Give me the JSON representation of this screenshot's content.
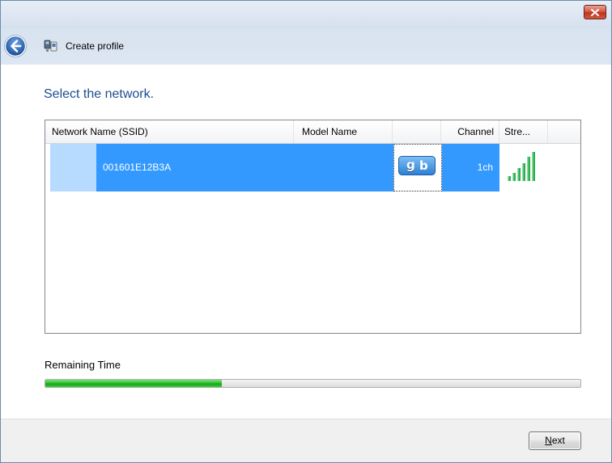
{
  "window": {
    "title": "Create profile"
  },
  "page": {
    "heading": "Select the network."
  },
  "list": {
    "columns": [
      "Network Name (SSID)",
      "Model Name",
      "",
      "Channel",
      "Stre..."
    ],
    "rows": [
      {
        "ssid": "001601E12B3A",
        "model_name": "",
        "type_icon": "gb-wireless-icon",
        "channel": "1ch",
        "strength_icon": "signal-strength-icon",
        "selected": true
      }
    ]
  },
  "progress": {
    "label": "Remaining Time",
    "value": 0.33
  },
  "footer": {
    "next_prefix": "N",
    "next_rest": "ext"
  },
  "colors": {
    "selection": "#3399ff",
    "heading": "#1e4d91",
    "progress": "#2fc22f"
  }
}
